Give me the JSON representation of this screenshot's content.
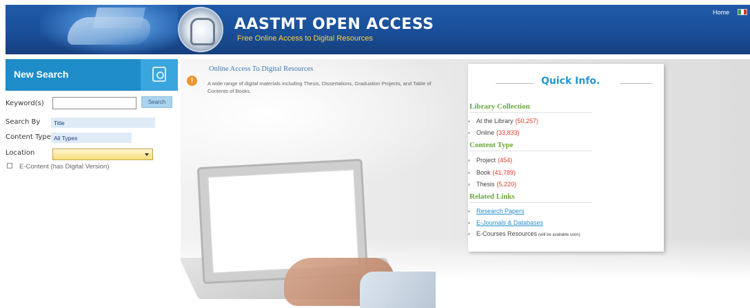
{
  "header": {
    "title": "AASTMT OPEN ACCESS",
    "subtitle": "Free Online Access to Digital Resources",
    "home_label": "Home",
    "colors": {
      "bar": "#1f5aa8",
      "subtitle": "#ffd23c"
    }
  },
  "search": {
    "title": "New Search",
    "keyword_label": "Keyword(s)",
    "keyword_value": "",
    "search_button": "Search",
    "search_by_label": "Search By",
    "search_by_value": "Title",
    "content_type_label": "Content Type",
    "content_type_value": "All Types",
    "location_label": "Location",
    "location_value": "",
    "econtent_label": "E-Content (has Digital Version)",
    "econtent_checked": false,
    "header_icon": "search-document-icon",
    "colors": {
      "header": "#1e8cc9",
      "location_select": "#f6dd7a"
    }
  },
  "intro": {
    "icon": "info-icon",
    "title": "Online Access To Digital Resources",
    "text": "A wide range of digital materials including Thesis, Dissertations, Graduation Projects, and Table of Contents of Books."
  },
  "quick_info": {
    "title": "Quick Info.",
    "library_collection": {
      "heading": "Library Collection",
      "items": [
        {
          "label": "At the Library",
          "count": "(50,257)"
        },
        {
          "label": "Online",
          "count": "(33,833)"
        }
      ]
    },
    "content_type": {
      "heading": "Content Type",
      "items": [
        {
          "label": "Project",
          "count": "(454)"
        },
        {
          "label": "Book",
          "count": "(41,789)"
        },
        {
          "label": "Thesis",
          "count": "(5,220)"
        }
      ]
    },
    "related_links": {
      "heading": "Related Links",
      "items": [
        {
          "label": "Research Papers"
        },
        {
          "label": "E-Journals & Databases"
        },
        {
          "label": "E-Courses Resources",
          "note": "(will be available soon)"
        }
      ]
    },
    "colors": {
      "title": "#2497cf",
      "section": "#67a838",
      "count": "#e03a2a",
      "link": "#2a8fcf"
    }
  }
}
